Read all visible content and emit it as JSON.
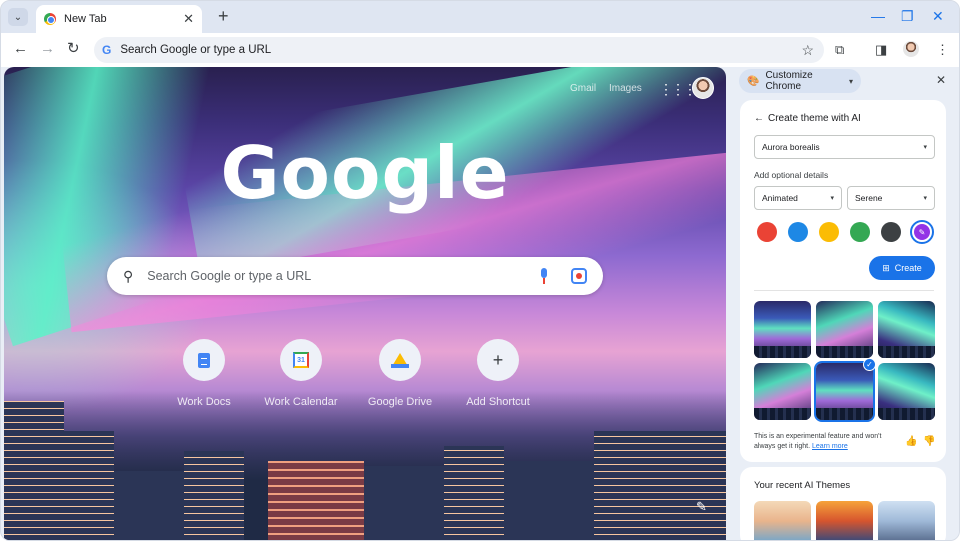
{
  "browser": {
    "tab_title": "New Tab",
    "tab_close": "✕",
    "new_tab": "+",
    "minimize": "—",
    "restore": "❐",
    "close": "✕",
    "tab_search": "⌄"
  },
  "toolbar": {
    "back": "←",
    "forward": "→",
    "reload": "↻",
    "omnibox_g": "G",
    "omnibox_text": "Search Google or type a URL",
    "bookmark_star": "☆",
    "extensions": "⧉",
    "side_panel": "◨",
    "menu": "⋮"
  },
  "ntp": {
    "gmail": "Gmail",
    "images": "Images",
    "apps": "⋮⋮⋮",
    "logo": "Google",
    "search_placeholder": "Search Google or type a URL",
    "search_icon": "⚲",
    "shortcuts": [
      {
        "label": "Work Docs"
      },
      {
        "label": "Work Calendar",
        "icon_text": "31"
      },
      {
        "label": "Google Drive"
      },
      {
        "label": "Add Shortcut",
        "icon_text": "+"
      }
    ],
    "customize_pencil": "✎"
  },
  "side_panel": {
    "header": "Customize Chrome",
    "header_icon": "🎨",
    "caret": "▾",
    "close": "✕",
    "back": "←",
    "title": "Create theme with AI",
    "subject_value": "Aurora borealis",
    "optional_label": "Add optional details",
    "style_value": "Animated",
    "mood_value": "Serene",
    "swatches": [
      "#ea4335",
      "#1e88e5",
      "#fbbc04",
      "#34a853",
      "#3c4043"
    ],
    "custom_swatch_color": "#9334e6",
    "create_label": "Create",
    "note_text": "This is an experimental feature and won't always get it right.",
    "learn_more": "Learn more",
    "thumbs_up": "👍",
    "thumbs_down": "👎",
    "recent_title": "Your recent AI Themes"
  },
  "colors": {
    "accent": "#1a73e8",
    "aurora_green": "#58f5c8",
    "aurora_pink": "#e7a3d3"
  }
}
